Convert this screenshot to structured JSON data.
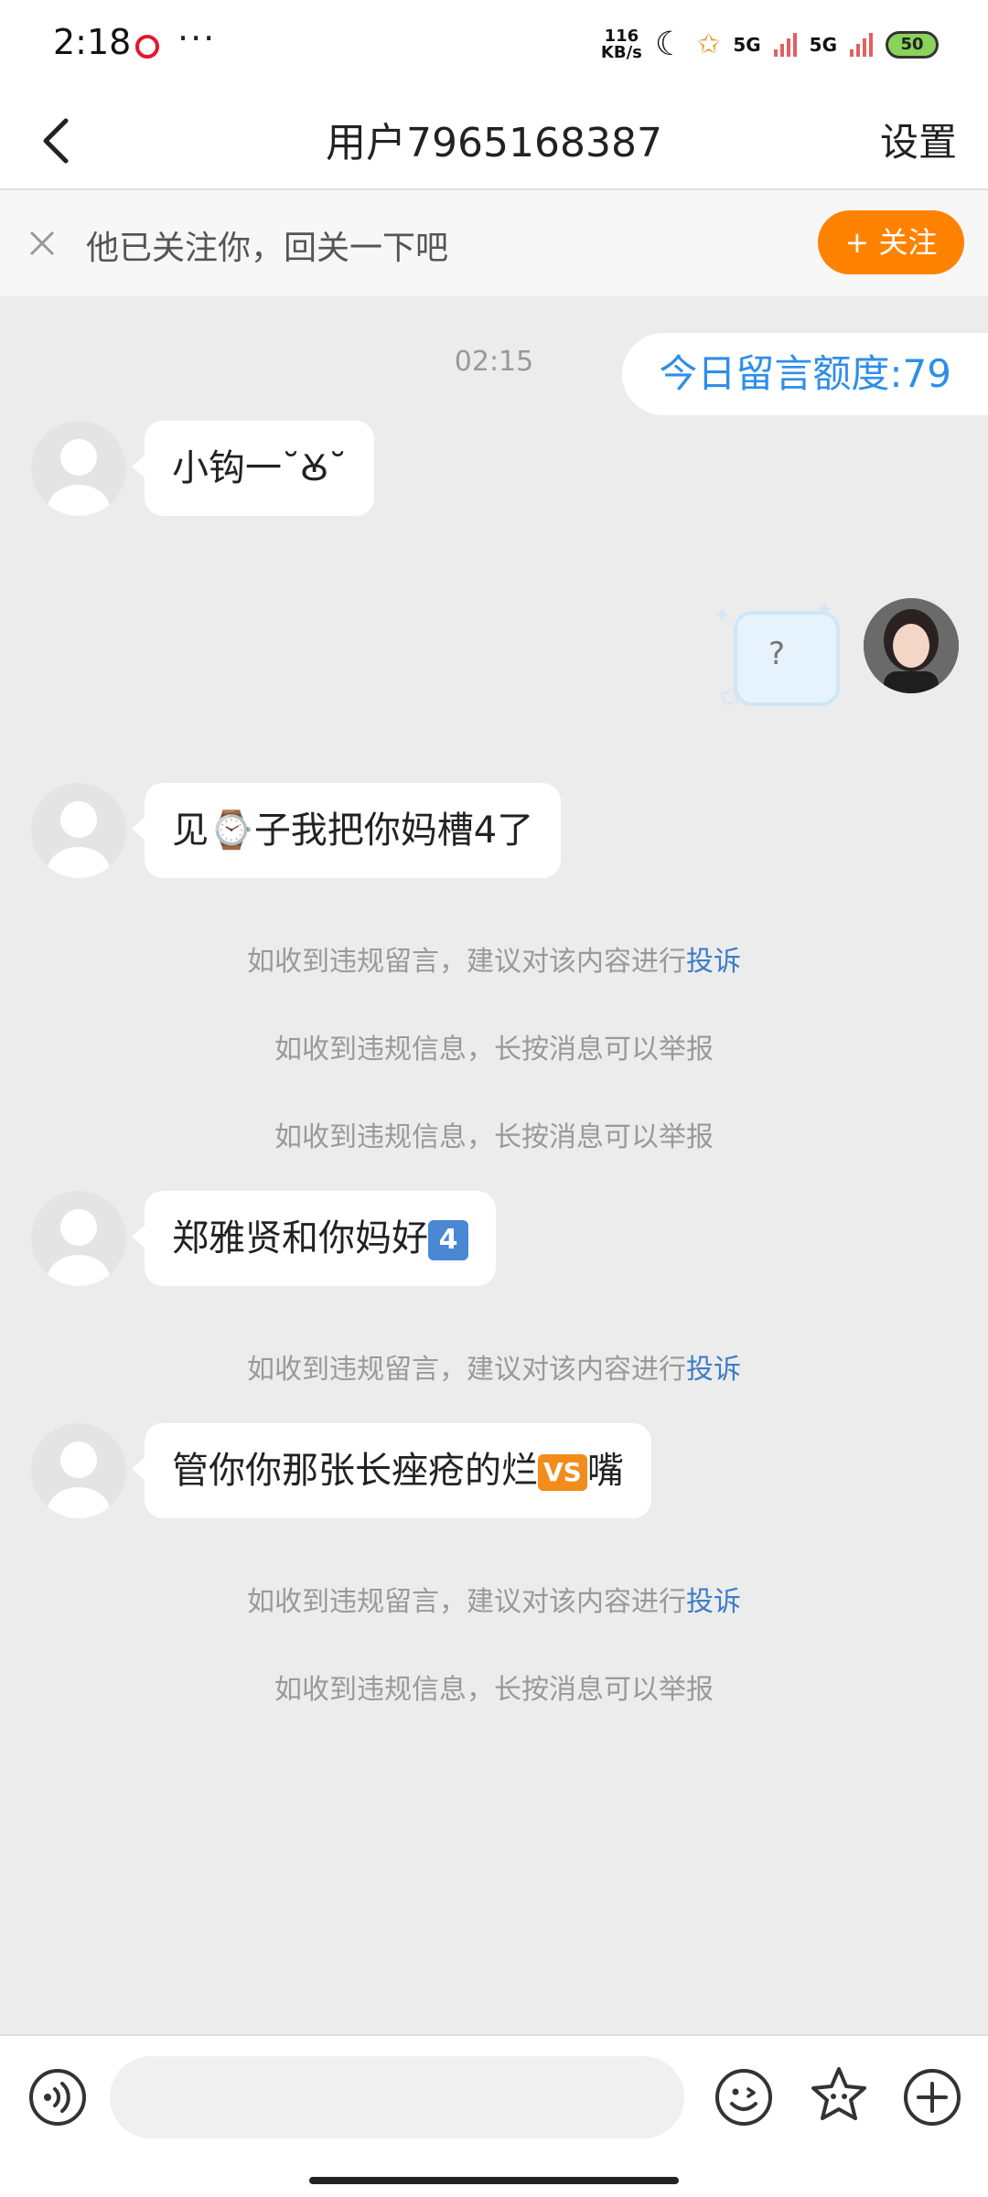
{
  "status_bar": {
    "time": "2:18",
    "more": "···",
    "speed_value": "116",
    "speed_unit": "KB/s",
    "network_1": "5G",
    "network_2": "5G",
    "battery": "50"
  },
  "nav": {
    "title": "用户7965168387",
    "settings": "设置"
  },
  "follow_banner": {
    "text": "他已关注你，回关一下吧",
    "follow_button": "+ 关注"
  },
  "chat": {
    "timestamp": "02:15",
    "quota": "今日留言额度:79",
    "sticker_text": "?",
    "messages": [
      {
        "text": "小钩一˘Ꙋ˘"
      },
      {
        "text_a": "见",
        "emoji": "⌚",
        "text_b": "子我把你妈槽4了"
      },
      {
        "text_a": "郑雅贤和你妈好",
        "badge": "4"
      },
      {
        "text_a": "管你你那张长痤疮的烂",
        "badge": "VS",
        "text_b": "嘴"
      }
    ],
    "notices": {
      "complaint_prefix": "如收到违规留言，建议对该内容进行",
      "complaint_link": "投诉",
      "report": "如收到违规信息，长按消息可以举报"
    }
  },
  "bottom_bar": {
    "input_placeholder": ""
  },
  "colors": {
    "accent_orange": "#ff8200",
    "link_blue": "#3d7cc6",
    "quota_blue": "#2f8ee8"
  }
}
